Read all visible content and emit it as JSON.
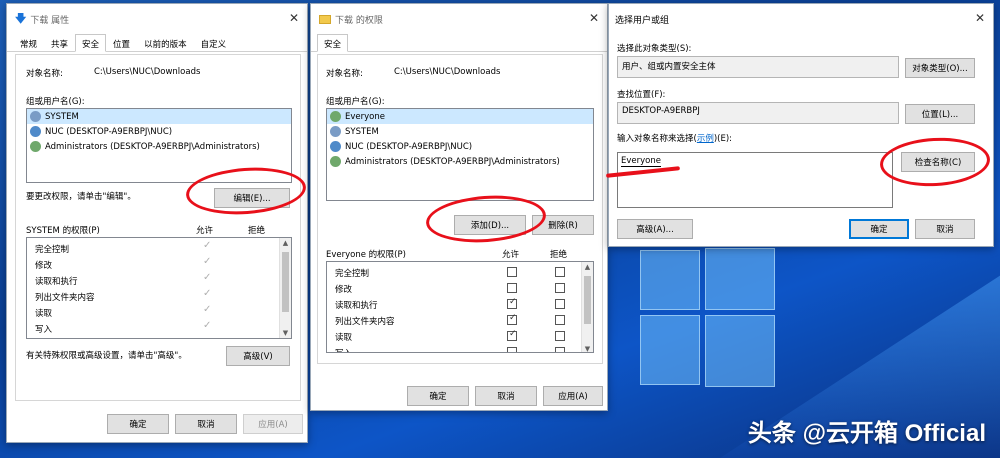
{
  "win1": {
    "title": "下载 属性",
    "tabs": [
      "常规",
      "共享",
      "安全",
      "位置",
      "以前的版本",
      "自定义"
    ],
    "object_label": "对象名称:",
    "object_value": "C:\\Users\\NUC\\Downloads",
    "groups_label": "组或用户名(G):",
    "users": [
      "SYSTEM",
      "NUC (DESKTOP-A9ERBPJ\\NUC)",
      "Administrators (DESKTOP-A9ERBPJ\\Administrators)"
    ],
    "change_hint": "要更改权限，请单击\"编辑\"。",
    "edit_button": "编辑(E)...",
    "perm_title": "SYSTEM 的权限(P)",
    "allow": "允许",
    "deny": "拒绝",
    "perms": [
      "完全控制",
      "修改",
      "读取和执行",
      "列出文件夹内容",
      "读取",
      "写入"
    ],
    "advanced_hint": "有关特殊权限或高级设置，请单击\"高级\"。",
    "advanced_button": "高级(V)",
    "ok": "确定",
    "cancel": "取消",
    "apply": "应用(A)"
  },
  "win2": {
    "title": "下载 的权限",
    "tab": "安全",
    "object_label": "对象名称:",
    "object_value": "C:\\Users\\NUC\\Downloads",
    "groups_label": "组或用户名(G):",
    "users": [
      "Everyone",
      "SYSTEM",
      "NUC (DESKTOP-A9ERBPJ\\NUC)",
      "Administrators (DESKTOP-A9ERBPJ\\Administrators)"
    ],
    "add_button": "添加(D)...",
    "remove_button": "删除(R)",
    "perm_title": "Everyone 的权限(P)",
    "allow": "允许",
    "deny": "拒绝",
    "perms": [
      "完全控制",
      "修改",
      "读取和执行",
      "列出文件夹内容",
      "读取",
      "写入"
    ],
    "ok": "确定",
    "cancel": "取消",
    "apply": "应用(A)"
  },
  "win3": {
    "title": "选择用户或组",
    "type_label": "选择此对象类型(S):",
    "type_value": "用户、组或内置安全主体",
    "type_button": "对象类型(O)...",
    "location_label": "查找位置(F):",
    "location_value": "DESKTOP-A9ERBPJ",
    "location_button": "位置(L)...",
    "name_label_pre": "输入对象名称来选择(",
    "name_label_link": "示例",
    "name_label_post": ")(E):",
    "name_value": "Everyone",
    "check_button": "检查名称(C)",
    "advanced_button": "高级(A)...",
    "ok": "确定",
    "cancel": "取消"
  },
  "watermark": "头条 @云开箱 Official"
}
